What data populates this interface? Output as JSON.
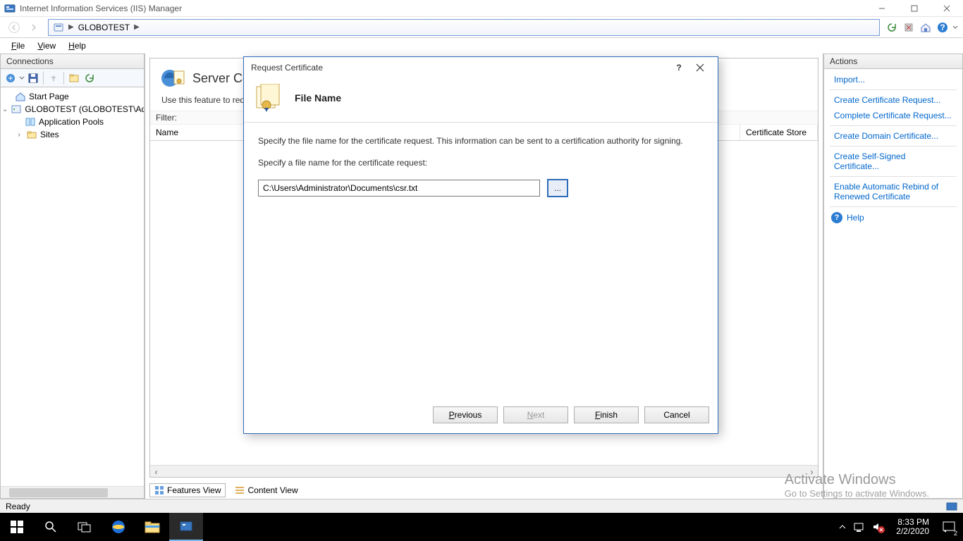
{
  "window": {
    "title": "Internet Information Services (IIS) Manager"
  },
  "breadcrumb": {
    "server": "GLOBOTEST"
  },
  "menu": {
    "file": "File",
    "view": "View",
    "help": "Help"
  },
  "connections": {
    "header": "Connections",
    "start_page": "Start Page",
    "server_node": "GLOBOTEST (GLOBOTEST\\Administrator)",
    "app_pools": "Application Pools",
    "sites": "Sites"
  },
  "center": {
    "title_partial": "Server Ce",
    "description_partial": "Use this feature to requ",
    "filter_label": "Filter:",
    "col_name": "Name",
    "col_store": "Certificate Store",
    "features_view": "Features View",
    "content_view": "Content View"
  },
  "dialog": {
    "title": "Request Certificate",
    "heading": "File Name",
    "p1": "Specify the file name for the certificate request. This information can be sent to a certification authority for signing.",
    "p2": "Specify a file name for the certificate request:",
    "path": "C:\\Users\\Administrator\\Documents\\csr.txt",
    "browse": "...",
    "previous": "Previous",
    "next": "Next",
    "finish": "Finish",
    "cancel": "Cancel"
  },
  "actions": {
    "header": "Actions",
    "import": "Import...",
    "create_request": "Create Certificate Request...",
    "complete_request": "Complete Certificate Request...",
    "create_domain": "Create Domain Certificate...",
    "create_self": "Create Self-Signed Certificate...",
    "enable_rebind": "Enable Automatic Rebind of Renewed Certificate",
    "help": "Help"
  },
  "status": {
    "ready": "Ready"
  },
  "watermark": {
    "l1": "Activate Windows",
    "l2": "Go to Settings to activate Windows."
  },
  "taskbar": {
    "time": "8:33 PM",
    "date": "2/2/2020",
    "notif_count": "2"
  }
}
